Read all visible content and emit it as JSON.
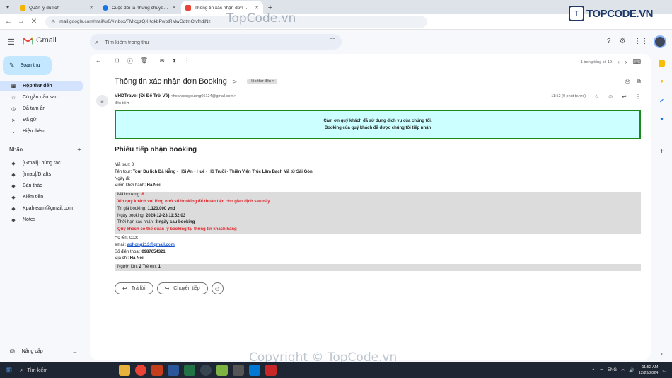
{
  "browser": {
    "tabs": [
      {
        "title": "Quản lý du lịch",
        "active": false,
        "color": "#f6b400"
      },
      {
        "title": "Cuộc đời là những chuyến đi",
        "active": false,
        "color": "#1a73e8"
      },
      {
        "title": "Thông tin xác nhận đơn Booking",
        "active": true,
        "color": "#ea4335"
      }
    ],
    "url": "mail.google.com/mail/u/0/#inbox/FMfcgzQXKqkbPwptRMwGdtmCtvfhdjNz"
  },
  "watermark": {
    "top": "TopCode.vn",
    "bottom": "Copyright © TopCode.vn",
    "logo_mark": "T",
    "logo_text": "TOPCODE.VN"
  },
  "gmail": {
    "app_name": "Gmail",
    "search_placeholder": "Tìm kiếm trong thư",
    "compose": "Soạn thư",
    "nav": [
      {
        "label": "Hộp thư đến",
        "icon": "inbox-icon",
        "active": true
      },
      {
        "label": "Có gắn dấu sao",
        "icon": "star-icon",
        "active": false
      },
      {
        "label": "Đã tạm ẩn",
        "icon": "clock-icon",
        "active": false
      },
      {
        "label": "Đã gửi",
        "icon": "send-icon",
        "active": false
      },
      {
        "label": "Hiện thêm",
        "icon": "chevron-down-icon",
        "active": false
      }
    ],
    "labels_header": "Nhãn",
    "labels": [
      "[Gmail]Thùng rác",
      "[Imap]/Drafts",
      "Bản thảo",
      "Kiểm tiền",
      "Kpahteam@gmail.com",
      "Notes"
    ],
    "upgrade": "Nâng cấp",
    "pager": "1 trong tổng số 19"
  },
  "email": {
    "subject": "Thông tin xác nhận đơn Booking",
    "label": "Hộp thư đến",
    "sender_name": "VHDTravel (Đi Để Trở Về)",
    "sender_email": "<hoahuongduong05124@gmail.com>",
    "to": "đến tôi",
    "time": "11:52 (0 phút trước)",
    "banner_line1": "Cảm ơn quý khách đã sử dụng dịch vụ của chúng tôi.",
    "banner_line2": "Booking của quý khách đã được chúng tôi tiếp nhận",
    "heading": "Phiếu tiếp nhận booking",
    "ma_tour_label": "Mã tour:",
    "ma_tour": "3",
    "ten_tour_label": "Tên tour:",
    "ten_tour": "Tour Du lịch Đà Nẵng - Hội An - Huế - Hồ Truồi - Thiền Viện Trúc Lâm Bạch Mã từ Sài Gòn",
    "ngay_di_label": "Ngày đi:",
    "diem_label": "Điểm khởi hành:",
    "diem": "Ha Noi",
    "ma_booking_label": "Mã booking:",
    "ma_booking": "8",
    "note1": "Xin quý khách vui lòng nhớ số booking để thuận tiện cho giao dịch sau này",
    "tri_gia_label": "Trị giá booking:",
    "tri_gia": "1.120.000 vnd",
    "ngay_booking_label": "Ngày booking:",
    "ngay_booking": "2024-12-23 11:52:03",
    "thoi_han_label": "Thời hạn xác nhận:",
    "thoi_han": "3 ngày sau booking",
    "note2": "Quý khách có thể quản lý booking tại thông tin khách hàng",
    "ho_ten_label": "Họ tên:",
    "ho_ten": "cccc",
    "email_label": "email:",
    "email": "aphong213@gmail.com",
    "sdt_label": "Số điện thoại:",
    "sdt": "0987654321",
    "dia_chi_label": "Địa chỉ:",
    "dia_chi": "Ha Noi",
    "nguoi_lon_label": "Người lớn:",
    "nguoi_lon": "2",
    "tre_em_label": "Trẻ em:",
    "tre_em": "1",
    "reply": "Trả lời",
    "forward": "Chuyển tiếp"
  },
  "taskbar": {
    "search": "Tìm kiếm",
    "lang": "ENG",
    "time": "11:52 AM",
    "date": "12/23/2024"
  }
}
